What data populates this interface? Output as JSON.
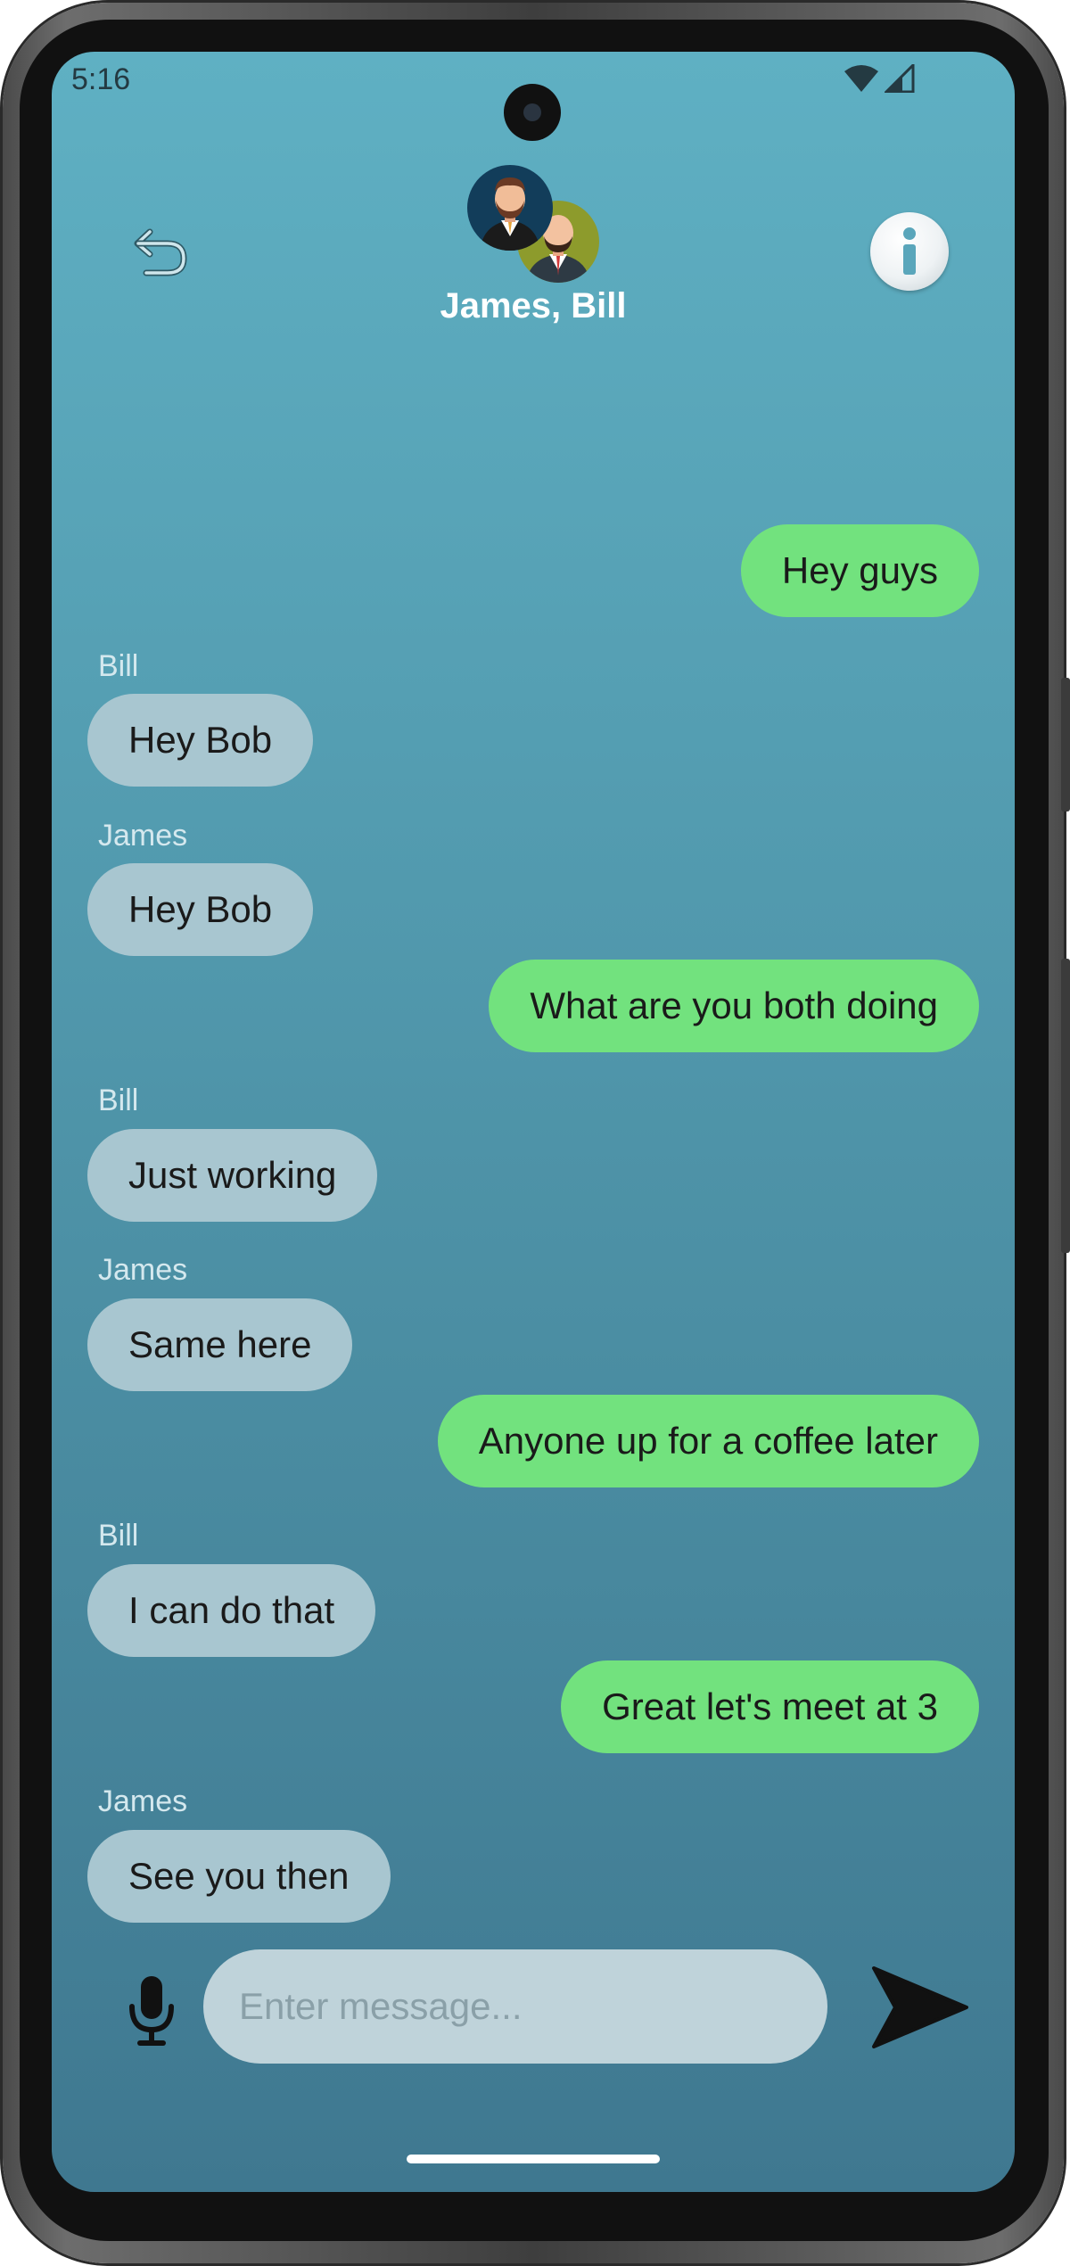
{
  "status_bar": {
    "time": "5:16",
    "icons": [
      "wifi-icon",
      "cellular-signal-icon"
    ]
  },
  "header": {
    "title": "James, Bill",
    "back_icon": "back-arrow-icon",
    "info_icon": "info-icon",
    "participants": [
      "James",
      "Bill"
    ]
  },
  "messages": [
    {
      "direction": "out",
      "text": "Hey guys"
    },
    {
      "direction": "in",
      "sender": "Bill",
      "text": "Hey Bob"
    },
    {
      "direction": "in",
      "sender": "James",
      "text": "Hey Bob"
    },
    {
      "direction": "out",
      "text": "What are you both doing"
    },
    {
      "direction": "in",
      "sender": "Bill",
      "text": "Just working"
    },
    {
      "direction": "in",
      "sender": "James",
      "text": "Same here"
    },
    {
      "direction": "out",
      "text": "Anyone up for a coffee later"
    },
    {
      "direction": "in",
      "sender": "Bill",
      "text": "I can do that"
    },
    {
      "direction": "out",
      "text": "Great let's meet at 3"
    },
    {
      "direction": "in",
      "sender": "James",
      "text": "See you then"
    }
  ],
  "composer": {
    "placeholder": "Enter message...",
    "value": "",
    "mic_icon": "microphone-icon",
    "send_icon": "send-icon"
  },
  "colors": {
    "outgoing_bubble": "#72e27e",
    "incoming_bubble": "#a8c6d0",
    "background_top": "#5fb0c3",
    "background_bottom": "#3f7890"
  }
}
